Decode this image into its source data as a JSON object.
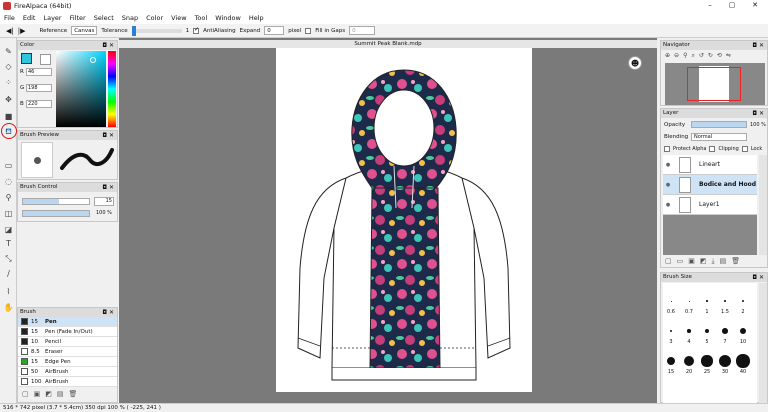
{
  "window": {
    "title": "FireAlpaca (64bit)",
    "min": "–",
    "max": "▢",
    "close": "✕"
  },
  "menu": [
    "File",
    "Edit",
    "Layer",
    "Filter",
    "Select",
    "Snap",
    "Color",
    "View",
    "Tool",
    "Window",
    "Help"
  ],
  "toolopts": {
    "reference_label": "Reference",
    "reference_value": "Canvas",
    "tolerance_label": "Tolerance",
    "tolerance_value": "1",
    "antialiasing": "AntiAliasing",
    "expand_label": "Expand",
    "expand_value": "0",
    "pixel": "pixel",
    "fill_gaps": "Fill in Gaps",
    "fill_gaps_value": "0"
  },
  "color_panel": {
    "title": "Color",
    "r_label": "R",
    "r": "46",
    "g_label": "G",
    "g": "198",
    "b_label": "B",
    "b": "220",
    "current": "#2ec6dc"
  },
  "brush_preview": {
    "title": "Brush Preview"
  },
  "brush_control": {
    "title": "Brush Control",
    "size": "15",
    "opacity": "100 %",
    "size_fill": 0.55,
    "opacity_fill": 1.0
  },
  "brush_panel": {
    "title": "Brush",
    "items": [
      {
        "size": "15",
        "name": "Pen",
        "color": "#222",
        "selected": true
      },
      {
        "size": "15",
        "name": "Pen (Fade In/Out)",
        "color": "#222",
        "selected": false
      },
      {
        "size": "10",
        "name": "Pencil",
        "color": "#222",
        "selected": false
      },
      {
        "size": "8.5",
        "name": "Eraser",
        "color": "#fff",
        "selected": false
      },
      {
        "size": "15",
        "name": "Edge Pen",
        "color": "#2a2",
        "selected": false
      },
      {
        "size": "50",
        "name": "AirBrush",
        "color": "#fff",
        "selected": false
      },
      {
        "size": "100",
        "name": "AirBrush",
        "color": "#fff",
        "selected": false
      }
    ]
  },
  "document": {
    "tab": "Summit Peak Blank.mdp"
  },
  "navigator": {
    "title": "Navigator"
  },
  "layer_panel": {
    "title": "Layer",
    "opacity_label": "Opacity",
    "opacity": "100 %",
    "blending_label": "Blending",
    "blending": "Normal",
    "protect_alpha": "Protect Alpha",
    "clipping": "Clipping",
    "lock": "Lock",
    "layers": [
      {
        "name": "Lineart",
        "selected": false
      },
      {
        "name": "Bodice and Hood",
        "selected": true
      },
      {
        "name": "Layer1",
        "selected": false
      }
    ]
  },
  "brush_size": {
    "title": "Brush Size",
    "labels": [
      "0.6",
      "0.7",
      "1",
      "1.5",
      "2",
      "3",
      "4",
      "5",
      "7",
      "10",
      "15",
      "20",
      "25",
      "30",
      "40"
    ]
  },
  "status": {
    "text": "516 * 742 pixel  (3.7 * 5.4cm)  350 dpi  100 %  ( -225, 241 )"
  }
}
